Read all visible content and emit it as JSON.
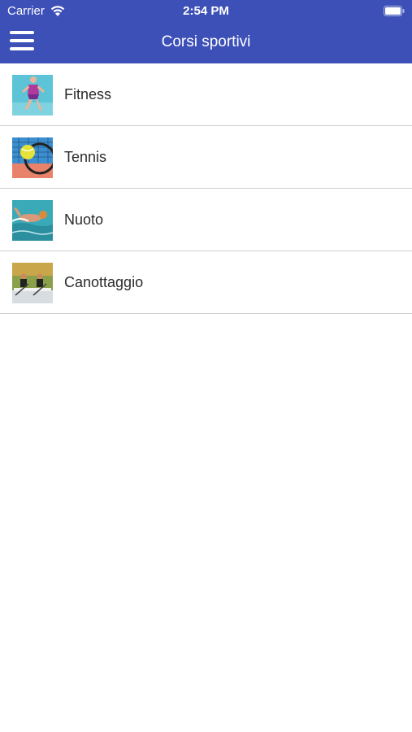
{
  "status_bar": {
    "carrier": "Carrier",
    "time": "2:54 PM",
    "wifi_icon": "wifi-icon",
    "battery_icon": "battery-icon"
  },
  "nav": {
    "title": "Corsi sportivi",
    "menu_icon": "hamburger-menu-icon"
  },
  "colors": {
    "header_bg": "#3d50b8",
    "header_text": "#ffffff",
    "list_text": "#2b2b2b",
    "separator": "#cfcfcf"
  },
  "courses": [
    {
      "label": "Fitness",
      "thumbnail": "fitness-thumbnail"
    },
    {
      "label": "Tennis",
      "thumbnail": "tennis-thumbnail"
    },
    {
      "label": "Nuoto",
      "thumbnail": "swimming-thumbnail"
    },
    {
      "label": "Canottaggio",
      "thumbnail": "rowing-thumbnail"
    }
  ]
}
